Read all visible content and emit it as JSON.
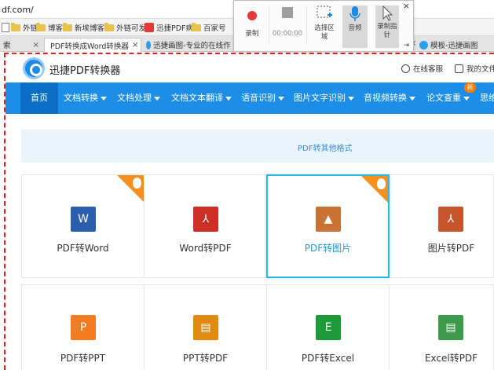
{
  "browser": {
    "url": "df.com/",
    "bookmarks": [
      "外链",
      "博客",
      "新埃博客",
      "外链可发",
      "迅捷PDF病",
      "百家号"
    ],
    "tabs": [
      {
        "label": "索",
        "close": "×"
      },
      {
        "label": "PDF转换成Word转换器",
        "close": "×"
      },
      {
        "label": "迅捷画图-专业的在线作",
        "close": "×"
      },
      {
        "label": "模板-迅捷画图",
        "close": "×"
      }
    ]
  },
  "recorder": {
    "record_label": "录制",
    "time": "00:00:00",
    "select_area_label": "选择区域",
    "audio_label": "音频",
    "record_cursor_label": "录制指针",
    "close": "×",
    "pin": "⇥"
  },
  "header": {
    "brand": "迅捷PDF转换器",
    "service": "在线客服",
    "my_files": "我的文件"
  },
  "nav": {
    "home": "首页",
    "items": [
      "文档转换",
      "文档处理",
      "文档文本翻译",
      "语音识别",
      "图片文字识别",
      "音视频转换",
      "论文查重",
      "思维"
    ],
    "new_badge": "新"
  },
  "banner": {
    "text": "PDF转其他格式"
  },
  "cards": [
    {
      "label": "PDF转Word",
      "icon": "W",
      "color": "#2b5fad",
      "hot": true
    },
    {
      "label": "Word转PDF",
      "icon": "⅄",
      "color": "#cc2f25",
      "hot": false
    },
    {
      "label": "PDF转图片",
      "icon": "▲",
      "color": "#c87234",
      "hot": true,
      "selected": true
    },
    {
      "label": "图片转PDF",
      "icon": "⅄",
      "color": "#c6552c",
      "hot": false
    },
    {
      "label": "PDF转PPT",
      "icon": "P",
      "color": "#f47c20",
      "hot": false
    },
    {
      "label": "PPT转PDF",
      "icon": "▤",
      "color": "#e08a12",
      "hot": false
    },
    {
      "label": "PDF转Excel",
      "icon": "E",
      "color": "#1f9a3a",
      "hot": false
    },
    {
      "label": "Excel转PDF",
      "icon": "▤",
      "color": "#3d9a4a",
      "hot": false
    }
  ],
  "colors": {
    "nav_bg": "#1c8ee7",
    "nav_active": "#0b6fc7",
    "selected_border": "#2cb5e6",
    "hot_tag": "#f5901e",
    "capture_frame": "#e02020"
  }
}
